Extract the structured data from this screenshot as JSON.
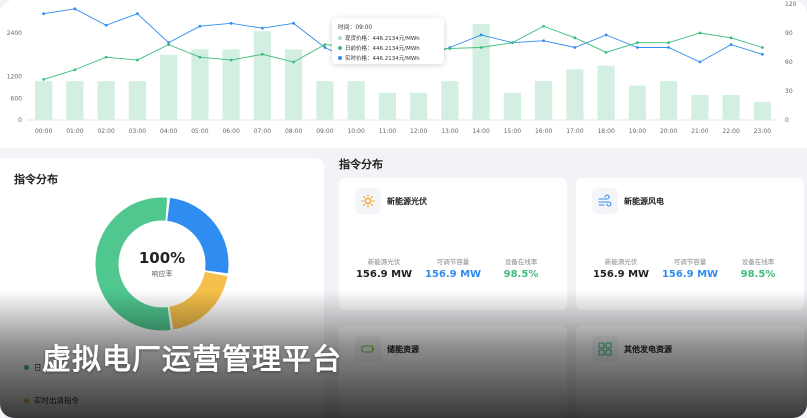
{
  "chart_data": {
    "type": "bar",
    "categories": [
      "00:00",
      "01:00",
      "02:00",
      "03:00",
      "04:00",
      "05:00",
      "06:00",
      "07:00",
      "08:00",
      "09:00",
      "10:00",
      "11:00",
      "12:00",
      "13:00",
      "14:00",
      "15:00",
      "16:00",
      "17:00",
      "18:00",
      "19:00",
      "20:00",
      "21:00",
      "22:00",
      "23:00"
    ],
    "series": [
      {
        "type": "bar",
        "axis": "left",
        "values": [
          1070,
          1070,
          1070,
          1070,
          1800,
          1950,
          1950,
          2450,
          1950,
          1070,
          1070,
          750,
          750,
          1070,
          2650,
          750,
          1070,
          1400,
          1500,
          950,
          1070,
          690,
          690,
          500
        ]
      },
      {
        "type": "line",
        "axis": "right",
        "values": [
          110,
          115,
          98,
          110,
          80,
          97,
          100,
          95,
          100,
          75,
          60,
          60,
          62,
          75,
          88,
          80,
          82,
          75,
          88,
          75,
          75,
          60,
          78,
          68
        ]
      },
      {
        "type": "line",
        "axis": "right",
        "values": [
          42,
          52,
          65,
          62,
          78,
          65,
          62,
          68,
          60,
          78,
          75,
          70,
          72,
          74,
          75,
          80,
          97,
          85,
          70,
          80,
          80,
          90,
          85,
          75
        ]
      }
    ],
    "left_axis": {
      "ticks": [
        "0",
        "600",
        "1200",
        "2400"
      ],
      "ylim": [
        0,
        3200
      ]
    },
    "right_axis": {
      "ticks": [
        "0",
        "30",
        "60",
        "90",
        "120"
      ],
      "ylim": [
        0,
        120
      ]
    },
    "colors": {
      "bar": "#d3efe2",
      "line_blue": "#2f8cf0",
      "line_green": "#3dbd7d"
    }
  },
  "tooltip": {
    "title": "时间：09:00",
    "rows": [
      {
        "label": "现货价格：446.2134元/MWh",
        "color": "#a7e3c6"
      },
      {
        "label": "日前价格：446.2134元/MWh",
        "color": "#3dbd7d"
      },
      {
        "label": "实时价格：446.2134元/MWh",
        "color": "#2f8cf0"
      }
    ]
  },
  "left_panel": {
    "title": "指令分布",
    "donut": {
      "percent": "100%",
      "label": "响应率",
      "segments": [
        {
          "value": 0.26,
          "color": "#2f8cf0"
        },
        {
          "value": 0.2,
          "color": "#f4c04a"
        },
        {
          "value": 0.54,
          "color": "#4fc78f"
        }
      ]
    },
    "legend": [
      {
        "label": "日",
        "color": "#3dbd7d"
      },
      {
        "label": "实时出清指令",
        "color": "#f4c04a"
      }
    ]
  },
  "right_section": {
    "title": "指令分布",
    "cards": [
      {
        "name": "新能源光伏",
        "icon": "sun-icon",
        "stats": [
          {
            "label": "新能源光伏",
            "value": "156.9 MW",
            "color": "#222222"
          },
          {
            "label": "可调节容量",
            "value": "156.9 MW",
            "color": "#2f8cf0"
          },
          {
            "label": "设备在线率",
            "value": "98.5%",
            "color": "#3dbd7d"
          }
        ]
      },
      {
        "name": "新能源风电",
        "icon": "wind-icon",
        "stats": [
          {
            "label": "新能源光伏",
            "value": "156.9 MW",
            "color": "#222222"
          },
          {
            "label": "可调节容量",
            "value": "156.9 MW",
            "color": "#2f8cf0"
          },
          {
            "label": "设备在线率",
            "value": "98.5%",
            "color": "#3dbd7d"
          }
        ]
      },
      {
        "name": "储能资源",
        "icon": "battery-icon"
      },
      {
        "name": "其他发电资源",
        "icon": "grid-icon"
      }
    ]
  },
  "banner": {
    "title": "虚拟电厂运营管理平台"
  }
}
